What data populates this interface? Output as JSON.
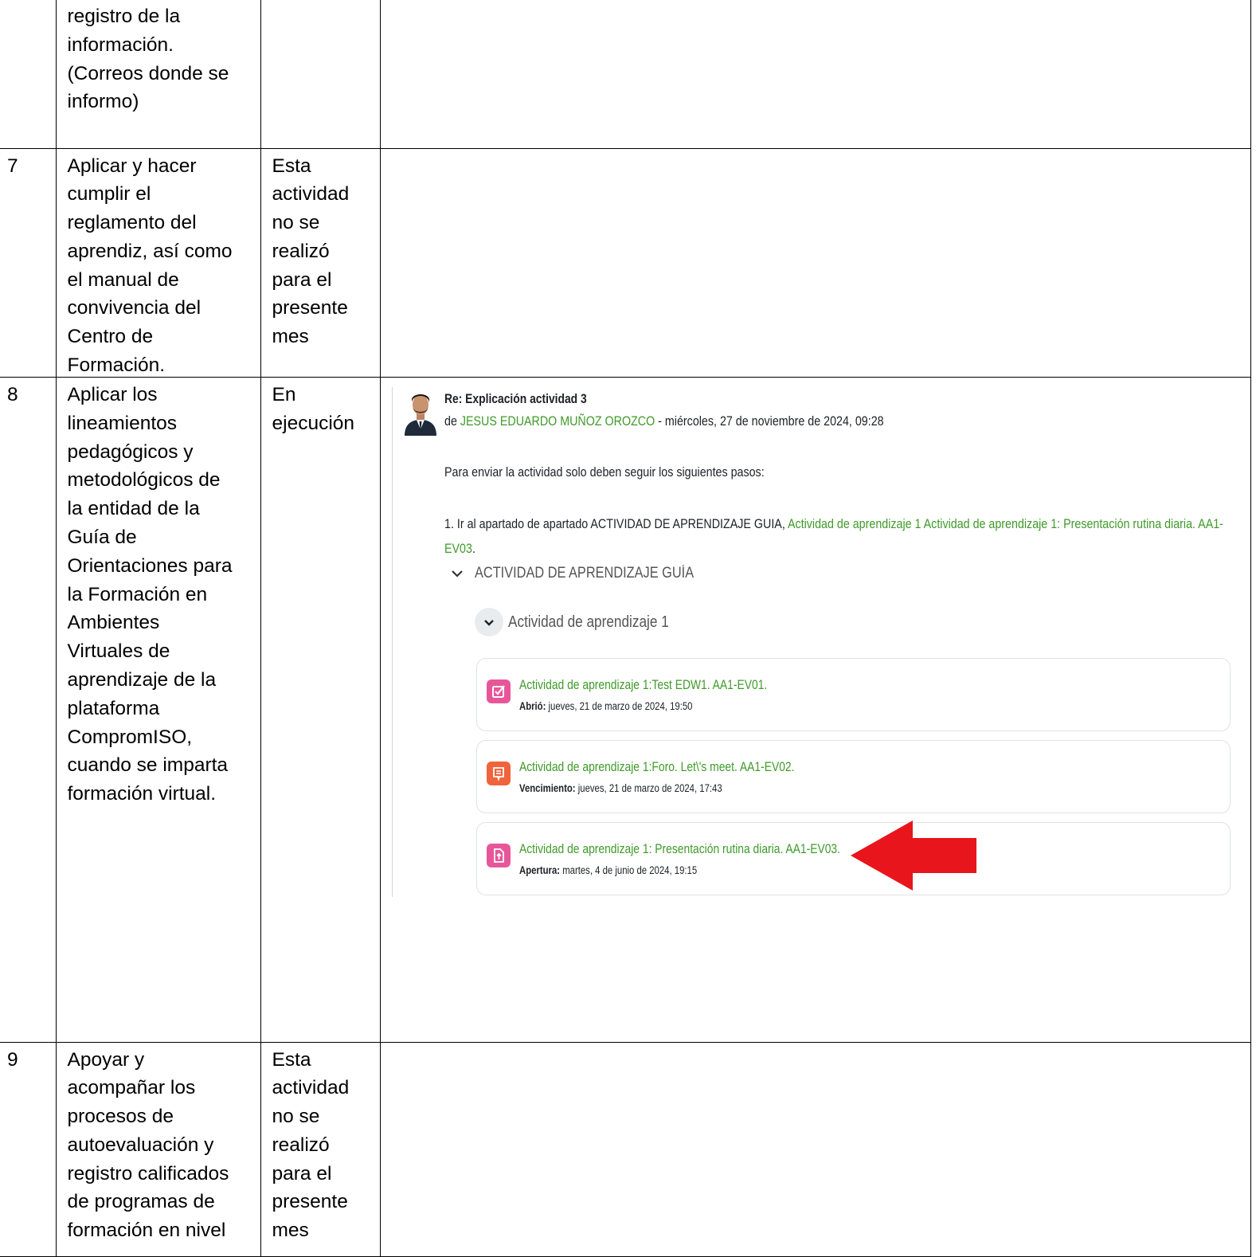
{
  "rows": [
    {
      "num": "",
      "activity": "registro de la\ninformación.\n(Correos donde se\ninformo)",
      "status": ""
    },
    {
      "num": "7",
      "activity": "Aplicar y hacer\ncumplir el\nreglamento del\naprendiz, así como\nel manual de\nconvivencia del\nCentro de\nFormación.",
      "status": "Esta\nactividad\nno se\nrealizó\npara el\npresente\nmes"
    },
    {
      "num": "8",
      "activity": "Aplicar los\nlineamientos\npedagógicos y\nmetodológicos de\nla entidad de la\nGuía de\nOrientaciones para\nla Formación en\nAmbientes\nVirtuales de\naprendizaje de la\nplataforma\nCompromISO,\ncuando se imparta\nformación virtual.",
      "status": "En\nejecución"
    },
    {
      "num": "9",
      "activity": "Apoyar y\nacompañar los\nprocesos de\nautoevaluación y\nregistro calificados\nde programas de\nformación en nivel",
      "status": "Esta\nactividad\nno se\nrealizó\npara el\npresente\nmes"
    }
  ],
  "evidence": {
    "subject": "Re: Explicación actividad 3",
    "meta_prefix": "de ",
    "author": "JESUS EDUARDO MUÑOZ OROZCO",
    "meta_suffix": " - miércoles, 27 de noviembre de 2024, 09:28",
    "para1": "Para enviar la actividad solo deben seguir los siguientes pasos:",
    "para2_text": "1. Ir al apartado de apartado ACTIVIDAD DE APRENDIZAJE GUIA, ",
    "para2_link": "Actividad de aprendizaje 1 Actividad de aprendizaje 1: Presentación rutina diaria. AA1-EV03",
    "para2_end": ".",
    "section": "ACTIVIDAD DE APRENDIZAJE GUÍA",
    "subsection": "Actividad de aprendizaje 1",
    "cards": [
      {
        "title": "Actividad de aprendizaje 1:Test EDW1. AA1-EV01.",
        "date_label": "Abrió:",
        "date": " jueves, 21 de marzo de 2024, 19:50",
        "icon": "quiz-icon",
        "color": "#e8569a"
      },
      {
        "title": "Actividad de aprendizaje 1:Foro. Let\\'s meet. AA1-EV02.",
        "date_label": "Vencimiento:",
        "date": " jueves, 21 de marzo de 2024, 17:43",
        "icon": "forum-icon",
        "color": "#f0643c"
      },
      {
        "title": "Actividad de aprendizaje 1: Presentación rutina diaria. AA1-EV03.",
        "date_label": "Apertura:",
        "date": " martes, 4 de junio de 2024, 19:15",
        "icon": "assignment-icon",
        "color": "#e8569a"
      }
    ],
    "accent_color": "#3f9a2a",
    "arrow_color": "#e8151c"
  }
}
